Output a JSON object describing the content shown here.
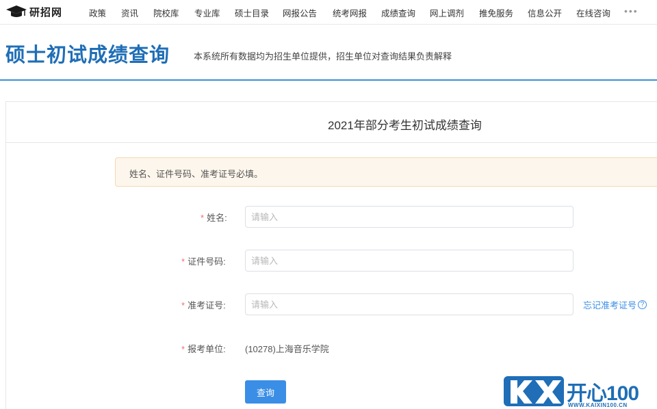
{
  "logo": {
    "text": "研招网"
  },
  "nav": {
    "items": [
      "政策",
      "资讯",
      "院校库",
      "专业库",
      "硕士目录",
      "网报公告",
      "统考网报",
      "成绩查询",
      "网上调剂",
      "推免服务",
      "信息公开",
      "在线咨询"
    ],
    "more": "•••"
  },
  "header": {
    "title": "硕士初试成绩查询",
    "subtitle": "本系统所有数据均为招生单位提供，招生单位对查询结果负责解释"
  },
  "card": {
    "title": "2021年部分考生初试成绩查询",
    "alert": "姓名、证件号码、准考证号必填。"
  },
  "form": {
    "required_mark": "*",
    "name_label": "姓名:",
    "id_label": "证件号码:",
    "ticket_label": "准考证号:",
    "unit_label": "报考单位:",
    "placeholder": "请输入",
    "unit_value": "(10278)上海音乐学院",
    "forgot_link": "忘记准考证号",
    "forgot_icon": "?",
    "submit": "查询"
  },
  "watermark": {
    "brand": "开心100",
    "url": "WWW.KAIXIN100.CN"
  },
  "colors": {
    "accent": "#3a8ee6",
    "title": "#1f6eb7",
    "required": "#f56c6c",
    "alert_bg": "#fdf6ec"
  }
}
